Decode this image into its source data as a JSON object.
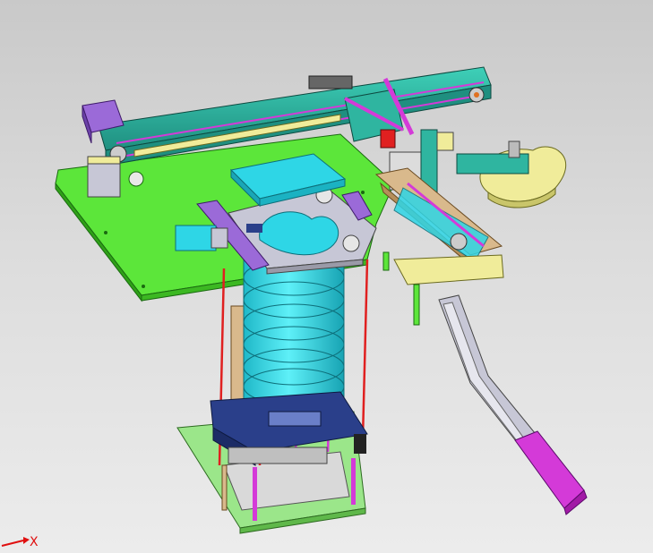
{
  "viewport": {
    "axis_label_x": "X",
    "axis_color": "#e01010",
    "background_top": "#c9c9c9",
    "background_bottom": "#ececec"
  },
  "model": {
    "colors": {
      "plate_green": "#5ce63a",
      "rail_teal": "#2fb5a0",
      "magenta": "#d43ad8",
      "cyan": "#2ed6e6",
      "yellow": "#f0ec9a",
      "purple": "#9b6ad8",
      "navy": "#2a3f8a",
      "silver": "#c7c7d6",
      "tan": "#d9b98c",
      "light_green": "#9be68a",
      "red_rod": "#e02020"
    }
  }
}
